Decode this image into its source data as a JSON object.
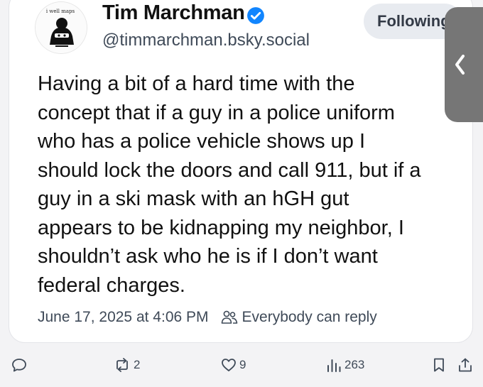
{
  "author": {
    "display_name": "Tim Marchman",
    "handle": "@timmarchman.bsky.social",
    "verified": true,
    "avatar_caption": "i well maps"
  },
  "follow_button": {
    "label": "Following"
  },
  "post": {
    "text": "Having a bit of a hard time with the\nconcept that if a guy in a police uniform\nwho has a police vehicle shows up I\nshould lock the doors and call 911, but if a\nguy in a ski mask with an hGH gut\nappears to be kidnapping my neighbor, I\nshouldn’t ask who he is if I don’t want\nfederal charges.",
    "timestamp": "June 17, 2025 at 4:06 PM",
    "reply_setting": "Everybody can reply"
  },
  "actions": {
    "reply_count": "",
    "repost_count": "2",
    "like_count": "9",
    "views_count": "263"
  },
  "icons": {
    "verified": "verified-badge-icon",
    "reply_setting": "people-icon",
    "reply": "speech-bubble-icon",
    "repost": "repost-arrows-icon",
    "like": "heart-icon",
    "views": "bar-chart-icon",
    "bookmark": "bookmark-icon",
    "share": "share-icon",
    "side_tab": "chevron-left-icon"
  },
  "colors": {
    "verified_blue": "#1185fe",
    "text": "#111111",
    "secondary_text": "#3f4a58",
    "button_bg": "#e8ebf0"
  }
}
